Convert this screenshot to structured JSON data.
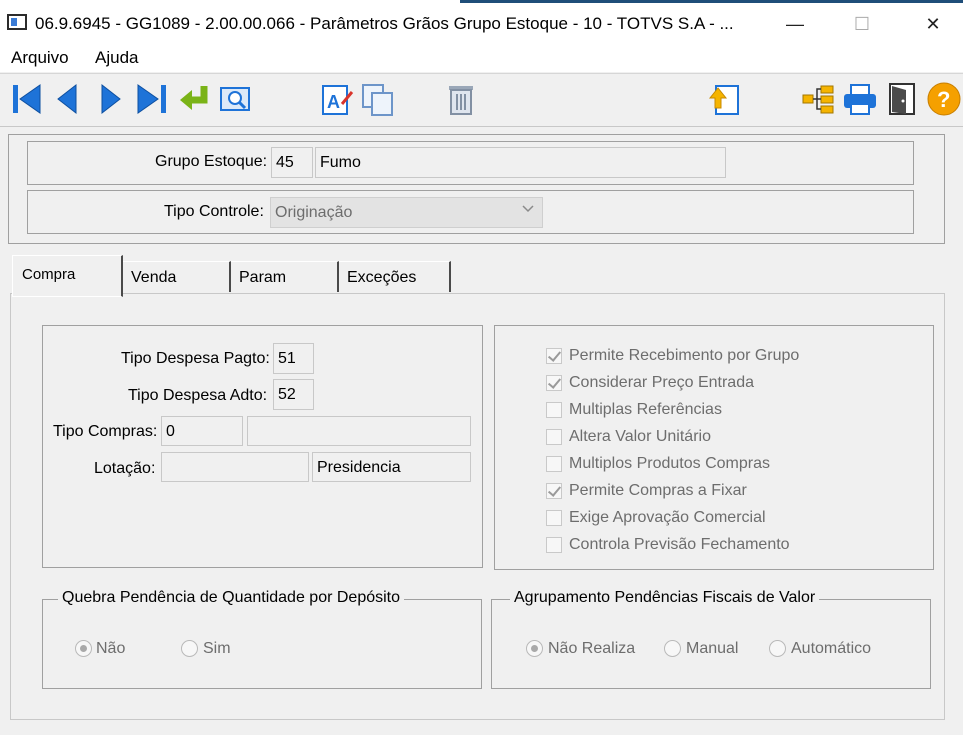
{
  "window": {
    "title": "06.9.6945 - GG1089 - 2.00.00.066 - Parâmetros Grãos Grupo Estoque - 10 - TOTVS S.A - ...",
    "minimize": "—",
    "maximize": "☐",
    "close": "✕"
  },
  "menu": {
    "items": [
      "Arquivo",
      "Ajuda"
    ]
  },
  "toolbar": {
    "buttons": [
      "first-icon",
      "prev-icon",
      "next-icon",
      "last-icon",
      "goto-icon",
      "search-icon",
      "edit-icon",
      "copy-icon",
      "delete-icon",
      "export-icon",
      "tree-icon",
      "print-icon",
      "exit-icon",
      "help-icon"
    ],
    "help_glyph": "?"
  },
  "header": {
    "grupo_estoque": {
      "label": "Grupo Estoque:",
      "code": "45",
      "description": "Fumo"
    },
    "tipo_controle": {
      "label": "Tipo Controle:",
      "value": "Originação"
    }
  },
  "tabs": [
    "Compra",
    "Venda",
    "Param",
    "Exceções"
  ],
  "compra": {
    "tipo_despesa_pagto": {
      "label": "Tipo Despesa Pagto:",
      "value": "51"
    },
    "tipo_despesa_adto": {
      "label": "Tipo Despesa Adto:",
      "value": "52"
    },
    "tipo_compras": {
      "label": "Tipo Compras:",
      "value": "0",
      "description": ""
    },
    "lotacao": {
      "label": "Lotação:",
      "value": "",
      "description": "Presidencia"
    },
    "checkboxes": [
      {
        "label": "Permite Recebimento por Grupo",
        "checked": true
      },
      {
        "label": "Considerar Preço Entrada",
        "checked": true
      },
      {
        "label": "Multiplas Referências",
        "checked": false
      },
      {
        "label": "Altera Valor Unitário",
        "checked": false
      },
      {
        "label": "Multiplos Produtos Compras",
        "checked": false
      },
      {
        "label": "Permite Compras a Fixar",
        "checked": true
      },
      {
        "label": "Exige Aprovação Comercial",
        "checked": false
      },
      {
        "label": "Controla Previsão Fechamento",
        "checked": false
      }
    ],
    "quebra": {
      "title": "Quebra Pendência de Quantidade por Depósito",
      "options": [
        "Não",
        "Sim"
      ],
      "selected": "Não"
    },
    "agrupamento": {
      "title": "Agrupamento Pendências Fiscais de Valor",
      "options": [
        "Não Realiza",
        "Manual",
        "Automático"
      ],
      "selected": "Não Realiza"
    }
  },
  "colors": {
    "accent": "#1f4e79",
    "tb_blue": "#1e73d8",
    "tb_green": "#7ab317",
    "help": "#f5a000"
  }
}
